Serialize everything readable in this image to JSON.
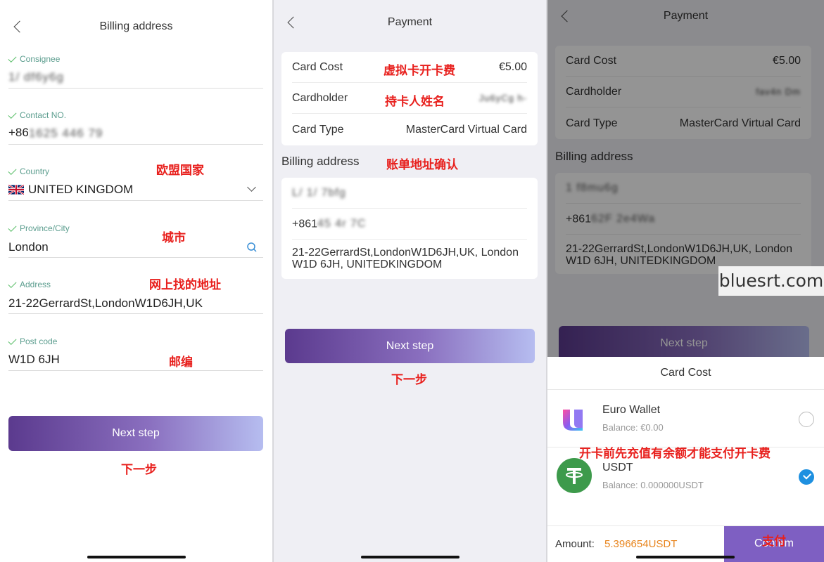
{
  "panel1": {
    "title": "Billing address",
    "fields": [
      {
        "label": "Consignee",
        "value": "",
        "blurred": "1/ df6y6g"
      },
      {
        "label": "Contact NO.",
        "value": "+86",
        "blurred": "1625 446 79"
      },
      {
        "label": "Country",
        "value": "UNITED KINGDOM"
      },
      {
        "label": "Province/City",
        "value": "London"
      },
      {
        "label": "Address",
        "value": "21-22GerrardSt,LondonW1D6JH,UK"
      },
      {
        "label": "Post code",
        "value": "W1D 6JH"
      }
    ],
    "annotations": {
      "country": "欧盟国家",
      "city": "城市",
      "address": "网上找的地址",
      "postcode": "邮编",
      "next": "下一步"
    },
    "next_label": "Next step"
  },
  "panel2": {
    "title": "Payment",
    "rows": [
      {
        "label": "Card Cost",
        "value": "€5.00"
      },
      {
        "label": "Cardholder",
        "value": "",
        "blurred": "Ju6yCg h-"
      },
      {
        "label": "Card Type",
        "value": "MasterCard Virtual Card"
      }
    ],
    "billing_title": "Billing address",
    "billing": {
      "name_blurred": "L/ 1/ 7bfg",
      "phone_prefix": "+861",
      "phone_blurred": "45 4r 7C",
      "address": "21-22GerrardSt,LondonW1D6JH,UK, London W1D 6JH, UNITEDKINGDOM"
    },
    "annotations": {
      "cost": "虚拟卡开卡费",
      "holder": "持卡人姓名",
      "billing": "账单地址确认",
      "next": "下一步"
    },
    "next_label": "Next step"
  },
  "panel3": {
    "title": "Payment",
    "rows": [
      {
        "label": "Card Cost",
        "value": "€5.00"
      },
      {
        "label": "Cardholder",
        "value": "",
        "blurred": "fav4n Dm"
      },
      {
        "label": "Card Type",
        "value": "MasterCard Virtual Card"
      }
    ],
    "billing_title": "Billing address",
    "billing": {
      "name_blurred": "1 f8mu6g",
      "phone_prefix": "+861",
      "phone_blurred": "62F 2e4Wa",
      "address": "21-22GerrardSt,LondonW1D6JH,UK, London W1D 6JH, UNITEDKINGDOM"
    },
    "next_label": "Next step",
    "sheet": {
      "title": "Card Cost",
      "options": [
        {
          "name": "Euro Wallet",
          "balance": "Balance: €0.00",
          "selected": false
        },
        {
          "name": "USDT",
          "balance": "Balance: 0.000000USDT",
          "selected": true
        }
      ],
      "amount_label": "Amount:",
      "amount_value": "5.396654USDT",
      "confirm_label": "Confirm"
    },
    "annotations": {
      "topup": "开卡前先充值有余额才能支付开卡费",
      "pay": "支付"
    },
    "watermark": "bluesrt.com"
  },
  "colors": {
    "annotation": "#e8201d",
    "accent_purple": "#7e5fc2",
    "amount_orange": "#e8851e",
    "usdt_green": "#3d9a4b"
  }
}
